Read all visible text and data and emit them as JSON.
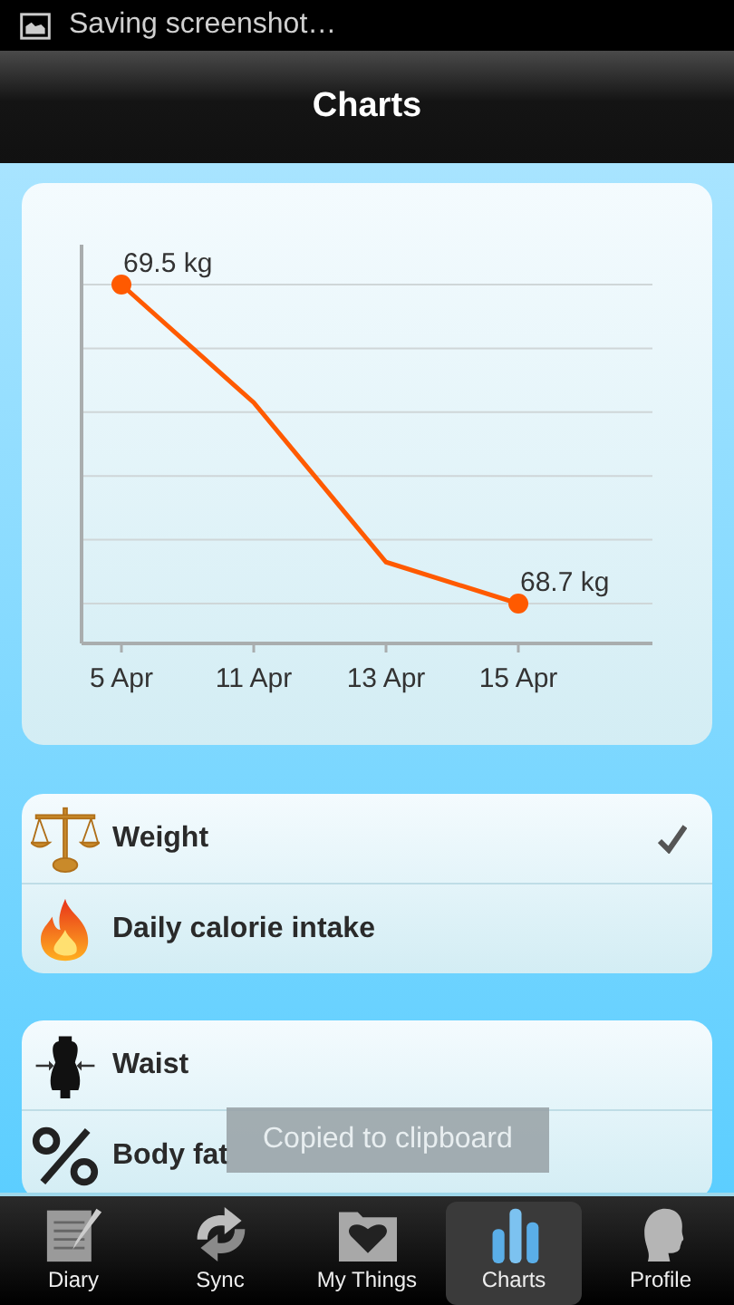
{
  "status_bar": {
    "notification": "Saving screenshot…"
  },
  "title_bar": {
    "title": "Charts"
  },
  "chart": {
    "x_labels": [
      "5 Apr",
      "11 Apr",
      "13 Apr",
      "15 Apr"
    ],
    "start_label": "69.5 kg",
    "end_label": "68.7 kg"
  },
  "metric_groups": [
    {
      "items": [
        {
          "label": "Weight",
          "checked": true
        },
        {
          "label": "Daily calorie intake",
          "checked": false
        }
      ]
    },
    {
      "items": [
        {
          "label": "Waist",
          "checked": false
        },
        {
          "label": "Body fat",
          "checked": false
        }
      ]
    }
  ],
  "toast": "Copied to clipboard",
  "tabs": [
    {
      "label": "Diary",
      "selected": false
    },
    {
      "label": "Sync",
      "selected": false
    },
    {
      "label": "My Things",
      "selected": false
    },
    {
      "label": "Charts",
      "selected": true
    },
    {
      "label": "Profile",
      "selected": false
    }
  ]
}
